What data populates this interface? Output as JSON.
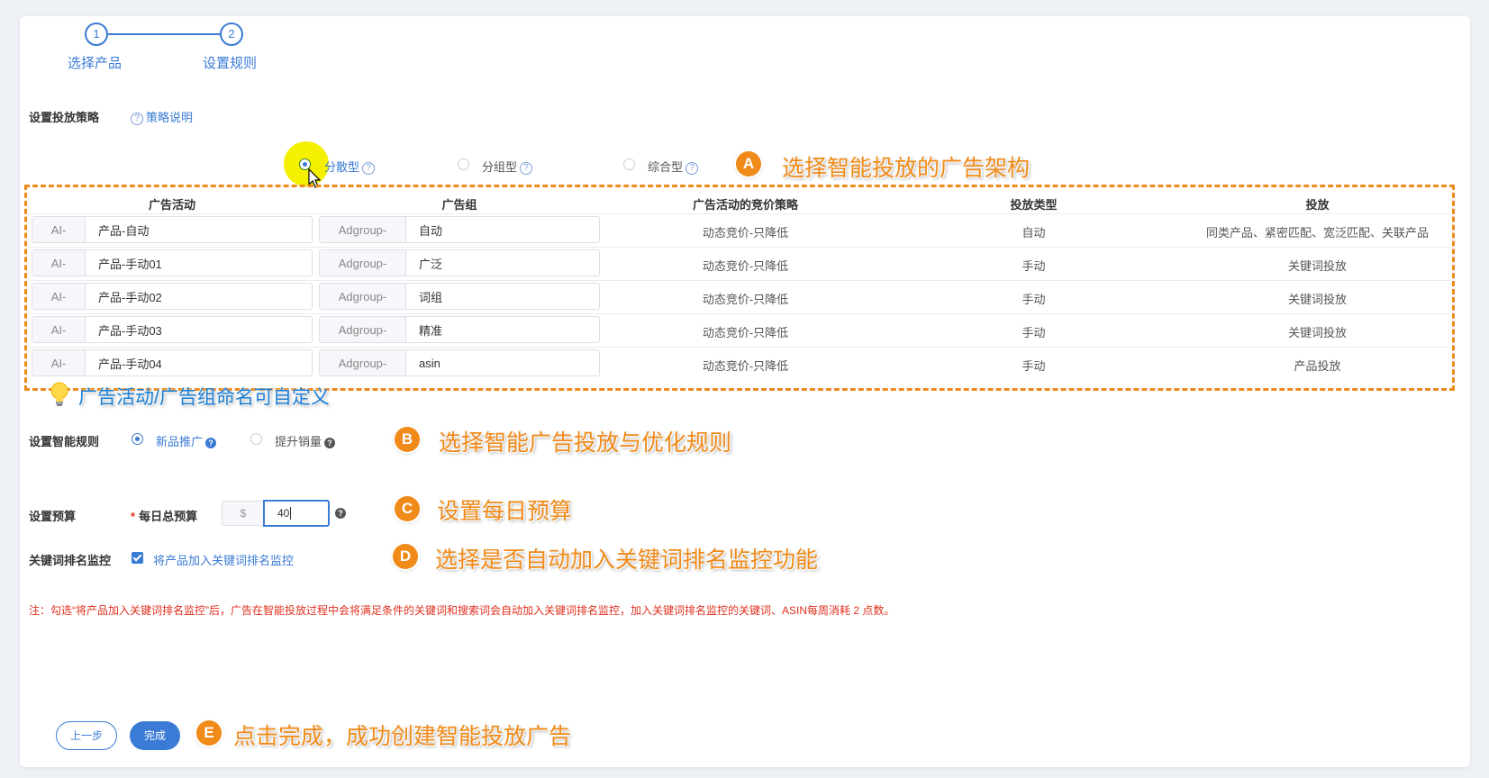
{
  "steps": [
    {
      "number": "1",
      "label": "选择产品"
    },
    {
      "number": "2",
      "label": "设置规则"
    }
  ],
  "strategy": {
    "label": "设置投放策略",
    "help": "策略说明",
    "options": [
      {
        "label": "分散型",
        "selected": true
      },
      {
        "label": "分组型",
        "selected": false
      },
      {
        "label": "综合型",
        "selected": false
      }
    ]
  },
  "table": {
    "headers": [
      "广告活动",
      "广告组",
      "广告活动的竞价策略",
      "投放类型",
      "投放"
    ],
    "rows": [
      {
        "campaign_prefix": "AI-",
        "campaign": "产品-自动",
        "group_prefix": "Adgroup-",
        "group": "自动",
        "bid": "动态竞价-只降低",
        "type": "自动",
        "targeting": "同类产品、紧密匹配、宽泛匹配、关联产品"
      },
      {
        "campaign_prefix": "AI-",
        "campaign": "产品-手动01",
        "group_prefix": "Adgroup-",
        "group": "广泛",
        "bid": "动态竞价-只降低",
        "type": "手动",
        "targeting": "关键词投放"
      },
      {
        "campaign_prefix": "AI-",
        "campaign": "产品-手动02",
        "group_prefix": "Adgroup-",
        "group": "词组",
        "bid": "动态竞价-只降低",
        "type": "手动",
        "targeting": "关键词投放"
      },
      {
        "campaign_prefix": "AI-",
        "campaign": "产品-手动03",
        "group_prefix": "Adgroup-",
        "group": "精准",
        "bid": "动态竞价-只降低",
        "type": "手动",
        "targeting": "关键词投放"
      },
      {
        "campaign_prefix": "AI-",
        "campaign": "产品-手动04",
        "group_prefix": "Adgroup-",
        "group": "asin",
        "bid": "动态竞价-只降低",
        "type": "手动",
        "targeting": "产品投放"
      }
    ]
  },
  "rule": {
    "label": "设置智能规则",
    "options": [
      {
        "label": "新品推广",
        "selected": true
      },
      {
        "label": "提升销量",
        "selected": false
      }
    ]
  },
  "budget": {
    "label": "设置预算",
    "required_mark": "*",
    "field_label": "每日总预算",
    "currency": "$",
    "value": "40"
  },
  "monitor": {
    "label": "关键词排名监控",
    "checkbox_label": "将产品加入关键词排名监控",
    "checked": true
  },
  "note": "注：勾选“将产品加入关键词排名监控”后，广告在智能投放过程中会将满足条件的关键词和搜索词会自动加入关键词排名监控，加入关键词排名监控的关键词、ASIN每周消耗 2 点数。",
  "buttons": {
    "prev": "上一步",
    "done": "完成"
  },
  "callouts": [
    {
      "badge": "A",
      "text": "选择智能投放的广告架构"
    },
    {
      "badge": "B",
      "text": "选择智能广告投放与优化规则"
    },
    {
      "badge": "C",
      "text": "设置每日预算"
    },
    {
      "badge": "D",
      "text": "选择是否自动加入关键词排名监控功能"
    },
    {
      "badge": "E",
      "text": "点击完成，成功创建智能投放广告"
    }
  ],
  "tip": "广告活动/广告组命名可自定义",
  "colors": {
    "accent": "#3a7bd5",
    "annotation_orange": "#f08a18",
    "note_red": "#e0301e",
    "tip_blue": "#1a7fd6"
  }
}
